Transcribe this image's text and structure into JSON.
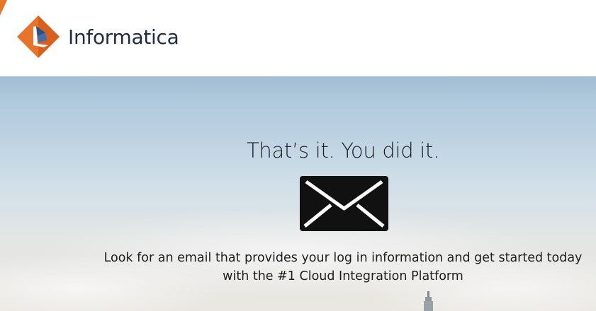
{
  "brand": {
    "name": "Informatica",
    "logo_icon": "informatica-diamond-logo",
    "colors": {
      "orange": "#e8742a",
      "navy": "#1f2d44",
      "text": "#222222"
    }
  },
  "confirmation": {
    "title": "That’s it. You did it.",
    "icon": "envelope-icon",
    "message_line_1": "Look for an email that provides your log in information and get started today",
    "message_line_2": "with the #1 Cloud Integration Platform"
  }
}
